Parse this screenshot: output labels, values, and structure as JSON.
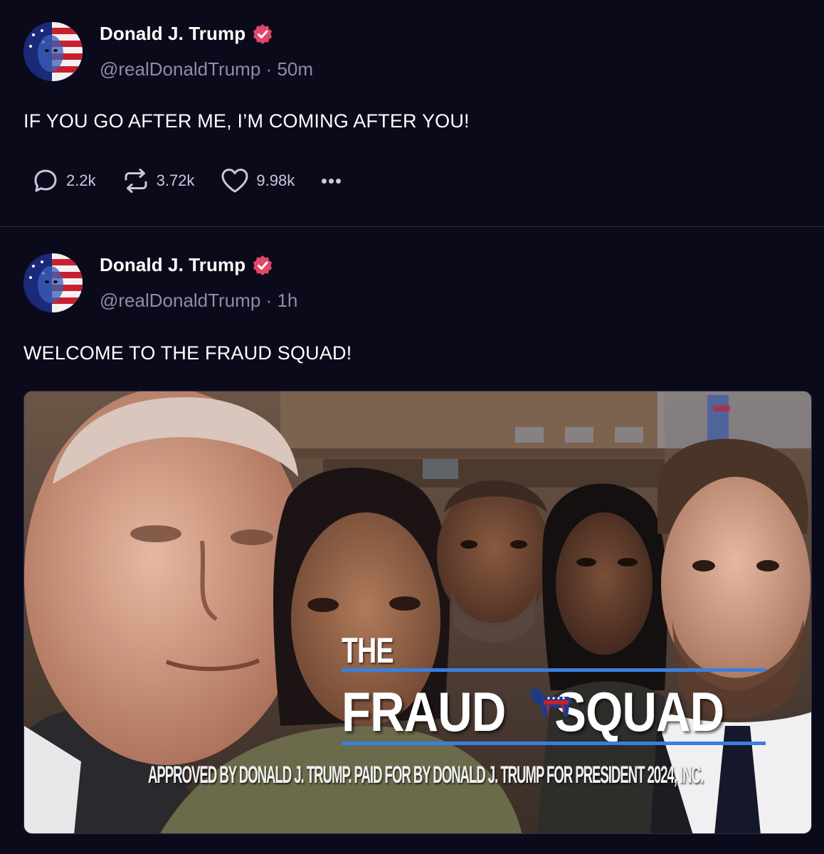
{
  "colors": {
    "background": "#0b0a1b",
    "verified_badge": "#e2476a",
    "secondary_text": "#8e8ca6",
    "action_text": "#c9c7da",
    "title_bar_blue": "#3a7fe0"
  },
  "posts": [
    {
      "author_name": "Donald J. Trump",
      "handle": "@realDonaldTrump",
      "separator": "·",
      "time": "50m",
      "text": "IF YOU GO AFTER ME, I’M COMING AFTER YOU!",
      "replies": "2.2k",
      "reposts": "3.72k",
      "likes": "9.98k",
      "avatar_icon": "profile-avatar",
      "verified_icon": "verified-badge-icon"
    },
    {
      "author_name": "Donald J. Trump",
      "handle": "@realDonaldTrump",
      "separator": "·",
      "time": "1h",
      "text": "WELCOME TO THE FRAUD SQUAD!",
      "avatar_icon": "profile-avatar",
      "verified_icon": "verified-badge-icon",
      "media": {
        "title_small": "THE",
        "title_left": "FRAUD",
        "title_right": "SQUAD",
        "logo": "democrat-donkey-logo",
        "disclaimer": "APPROVED BY DONALD J. TRUMP. PAID FOR BY DONALD J. TRUMP FOR PRESIDENT 2024, INC."
      }
    }
  ]
}
